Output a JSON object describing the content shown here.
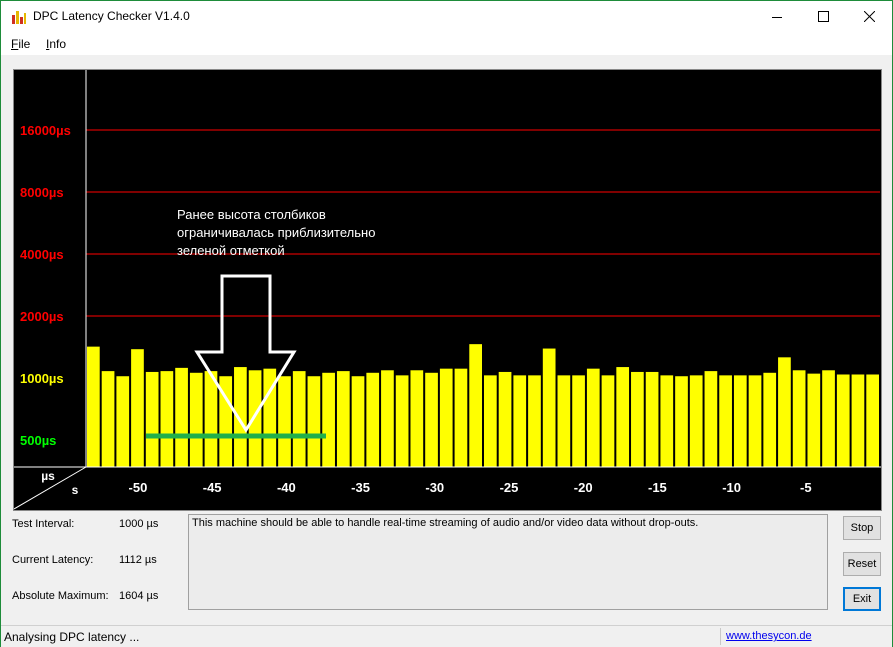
{
  "window": {
    "title": "DPC Latency Checker V1.4.0",
    "border_color": "#1e8c3a"
  },
  "menu": {
    "file_first": "F",
    "file_rest": "ile",
    "info_first": "I",
    "info_rest": "nfo"
  },
  "chart_data": {
    "type": "bar",
    "y_scale": "log2",
    "y_ticks": [
      {
        "label": "16000µs",
        "value": 16000,
        "color": "#ff0000"
      },
      {
        "label": "8000µs",
        "value": 8000,
        "color": "#ff0000"
      },
      {
        "label": "4000µs",
        "value": 4000,
        "color": "#ff0000"
      },
      {
        "label": "2000µs",
        "value": 2000,
        "color": "#ff0000"
      },
      {
        "label": "1000µs",
        "value": 1000,
        "color": "#ffff00"
      },
      {
        "label": "500µs",
        "value": 500,
        "color": "#00ff00"
      }
    ],
    "x_ticks": [
      "-50",
      "-45",
      "-40",
      "-35",
      "-30",
      "-25",
      "-20",
      "-15",
      "-10",
      "-5"
    ],
    "x_tick_values": [
      -50,
      -45,
      -40,
      -35,
      -30,
      -25,
      -20,
      -15,
      -10,
      -5
    ],
    "corner_top": "µs",
    "corner_bottom": "s",
    "xlim": [
      -53.5,
      0
    ],
    "bar_color": "#ffff00",
    "values": [
      1420,
      1080,
      1020,
      1380,
      1070,
      1080,
      1120,
      1060,
      1080,
      1020,
      1130,
      1090,
      1110,
      1020,
      1080,
      1020,
      1060,
      1080,
      1020,
      1060,
      1090,
      1030,
      1090,
      1060,
      1110,
      1110,
      1460,
      1030,
      1070,
      1030,
      1030,
      1390,
      1030,
      1030,
      1110,
      1030,
      1130,
      1070,
      1070,
      1030,
      1020,
      1030,
      1080,
      1030,
      1030,
      1030,
      1060,
      1260,
      1090,
      1050,
      1090,
      1040,
      1040,
      1040
    ]
  },
  "annotation": {
    "text_line1": "Ранее высота столбиков",
    "text_line2": "ограничивалась приблизительно",
    "text_line3": "зеленой отметкой",
    "green_line_color": "#21b04b"
  },
  "info": {
    "test_interval_label": "Test Interval:",
    "test_interval_value": "1000 µs",
    "current_latency_label": "Current Latency:",
    "current_latency_value": "1112 µs",
    "absolute_maximum_label": "Absolute Maximum:",
    "absolute_maximum_value": "1604 µs"
  },
  "message": "This machine should be able to handle real-time streaming of audio and/or video data without drop-outs.",
  "buttons": {
    "stop": "Stop",
    "reset": "Reset",
    "exit": "Exit"
  },
  "status": {
    "text": "Analysing DPC latency ...",
    "link": "www.thesycon.de"
  }
}
